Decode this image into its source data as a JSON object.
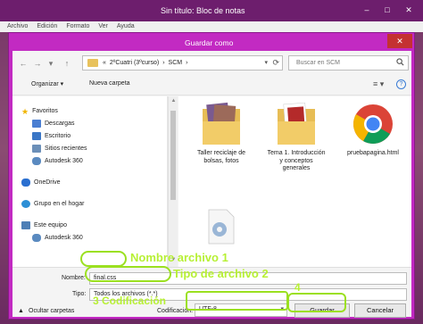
{
  "notepad": {
    "title": "Sin título: Bloc de notas",
    "menu": [
      "Archivo",
      "Edición",
      "Formato",
      "Ver",
      "Ayuda"
    ],
    "min": "–",
    "max": "□",
    "close": "✕"
  },
  "dialog": {
    "title": "Guardar como",
    "close": "✕",
    "nav": {
      "back": "←",
      "forward": "→",
      "dropdown": "▾",
      "up": "↑",
      "crumbs": [
        "«",
        "2ºCuatri (3ºcurso)",
        "›",
        "SCM",
        "›"
      ],
      "addr_dropdown": "▾",
      "refresh": "⟳",
      "search_placeholder": "Buscar en SCM",
      "search_icon": "search-icon"
    },
    "toolbar": {
      "organize": "Organizar ▾",
      "new_folder": "Nueva carpeta",
      "view_icon": "≡ ▾",
      "help_icon": "?"
    },
    "sidebar": {
      "items": [
        {
          "label": "Favoritos",
          "icon": "star-icon",
          "color": "#f0b400"
        },
        {
          "label": "Descargas",
          "icon": "downloads-icon",
          "color": "#4a7ed2"
        },
        {
          "label": "Escritorio",
          "icon": "desktop-icon",
          "color": "#3a76c6"
        },
        {
          "label": "Sitios recientes",
          "icon": "recent-icon",
          "color": "#6b8fb8"
        },
        {
          "label": "Autodesk 360",
          "icon": "cloud-icon",
          "color": "#5a8ac0"
        },
        {
          "label": "OneDrive",
          "icon": "onedrive-icon",
          "color": "#2a6fd0"
        },
        {
          "label": "Grupo en el hogar",
          "icon": "homegroup-icon",
          "color": "#2d8fd6"
        },
        {
          "label": "Este equipo",
          "icon": "computer-icon",
          "color": "#4e7fb6"
        },
        {
          "label": "Autodesk 360",
          "icon": "cloud-icon",
          "color": "#5a8ac0"
        }
      ]
    },
    "files": [
      {
        "name": "Taller reciclaje de bolsas, fotos",
        "type": "folder-photos"
      },
      {
        "name": "Tema 1. Introducción y conceptos generales",
        "type": "folder-docs"
      },
      {
        "name": "pruebapagina.html",
        "type": "chrome-file"
      },
      {
        "name": "",
        "type": "settings-file"
      }
    ],
    "bottom": {
      "filename_label": "Nombre:",
      "filename_value": "final.css",
      "type_label": "Tipo:",
      "type_value": "Todos los archivos  (*.*)",
      "hide_folders": "Ocultar carpetas",
      "encoding_label": "Codificación:",
      "encoding_value": "UTF-8",
      "save": "Guardar",
      "cancel": "Cancelar",
      "hide_toggle_icon": "▲"
    }
  },
  "annotations": {
    "a1": "Nombre archivo 1",
    "a2": "Tipo de archivo 2",
    "a3": "3  Codificación",
    "a4": "4",
    "color": "#9be020"
  }
}
